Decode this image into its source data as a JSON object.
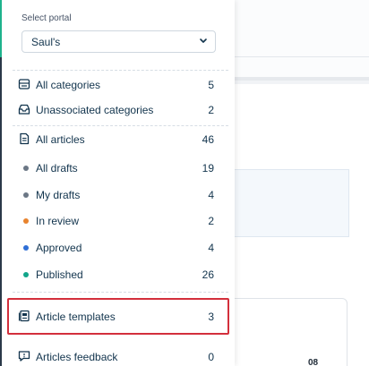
{
  "portal": {
    "label": "Select portal",
    "selected": "Saul's"
  },
  "nav": {
    "categories": [
      {
        "label": "All categories",
        "count": "5",
        "icon": "categories-icon"
      },
      {
        "label": "Unassociated categories",
        "count": "2",
        "icon": "inbox-icon"
      }
    ],
    "all_articles": {
      "label": "All articles",
      "count": "46",
      "icon": "document-icon"
    },
    "statuses": [
      {
        "label": "All drafts",
        "count": "19",
        "color": "#6b7785"
      },
      {
        "label": "My drafts",
        "count": "4",
        "color": "#6b7785"
      },
      {
        "label": "In review",
        "count": "2",
        "color": "#e8832e"
      },
      {
        "label": "Approved",
        "count": "4",
        "color": "#2f6fd6"
      },
      {
        "label": "Published",
        "count": "26",
        "color": "#12a58a"
      }
    ],
    "templates": {
      "label": "Article templates",
      "count": "3",
      "icon": "template-icon"
    },
    "feedback": {
      "label": "Articles feedback",
      "count": "0",
      "icon": "feedback-icon"
    }
  },
  "background": {
    "card_number": "08"
  },
  "colors": {
    "accent": "#1fb58f",
    "highlight": "#d32f3c"
  }
}
